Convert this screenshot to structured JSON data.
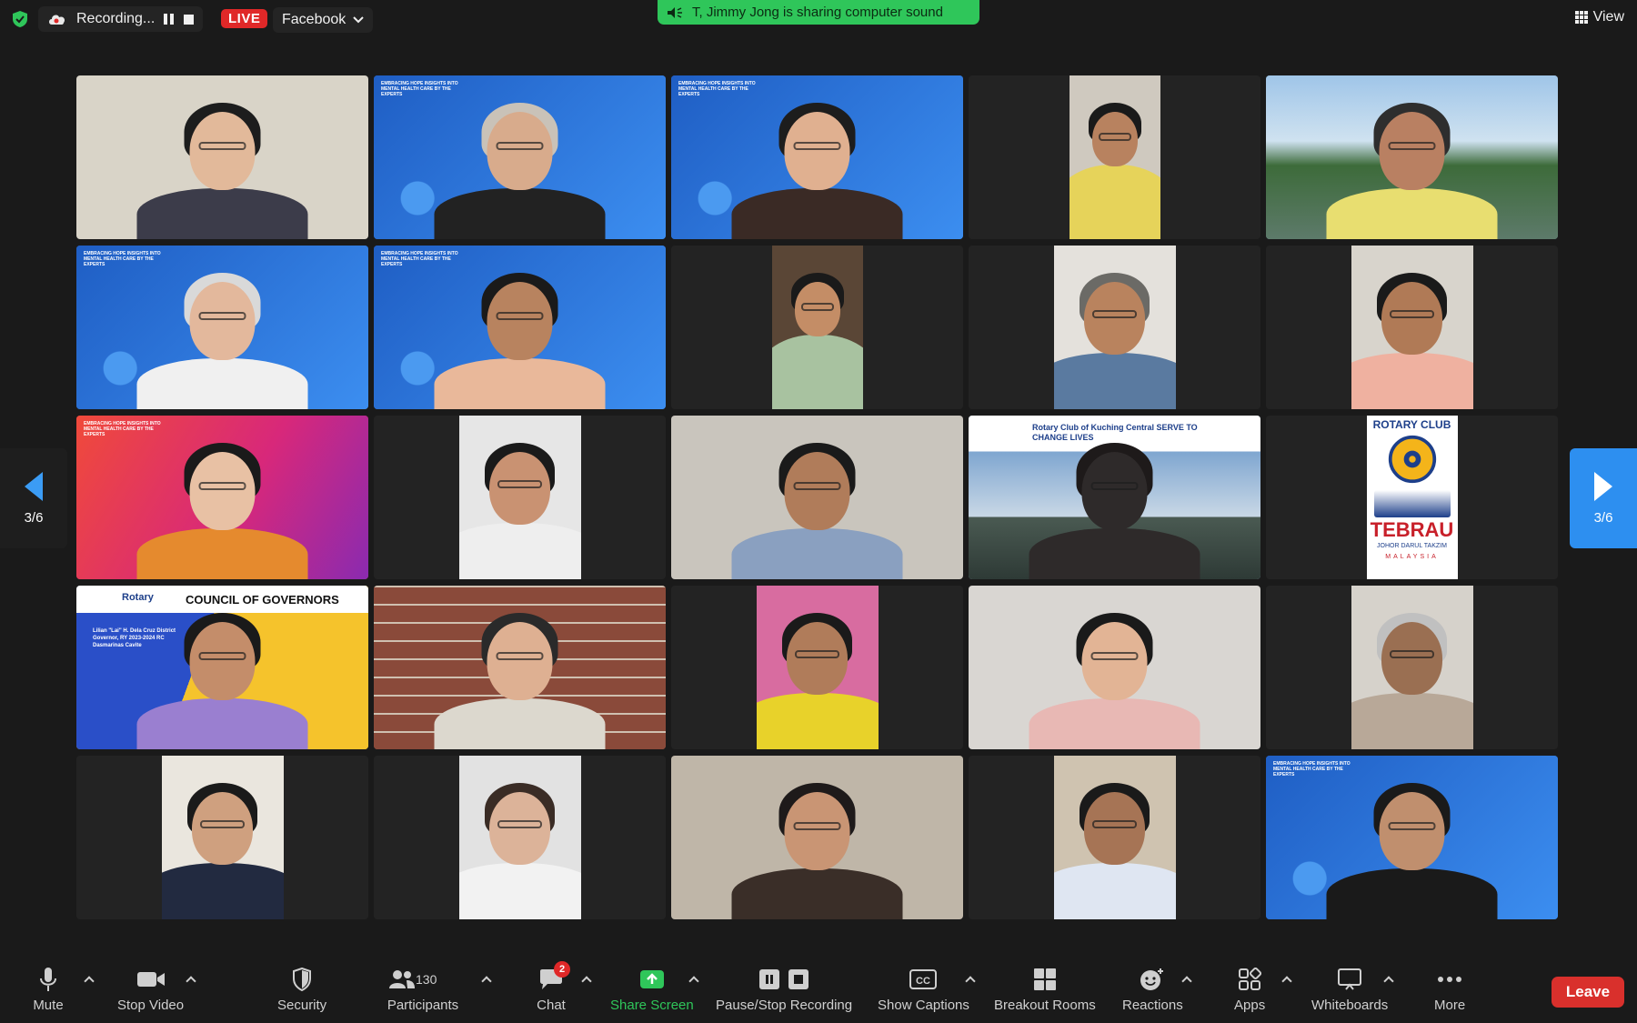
{
  "topbar": {
    "recording_label": "Recording...",
    "live_label": "LIVE",
    "stream_target": "Facebook",
    "sharing_notice": "T, Jimmy Jong is sharing computer sound",
    "view_label": "View"
  },
  "navigation": {
    "page_indicator_left": "3/6",
    "page_indicator_right": "3/6"
  },
  "tiles": [
    {
      "name": "participant-video-1",
      "bg": "#d9d4c8",
      "kind": "full"
    },
    {
      "name": "participant-video-2",
      "bg": "#2a6fd6",
      "kind": "full",
      "banner": "EMBRACING HOPE INSIGHTS INTO MENTAL HEALTH CARE BY THE EXPERTS"
    },
    {
      "name": "participant-video-3",
      "bg": "#2a6fd6",
      "kind": "full",
      "banner": "EMBRACING HOPE INSIGHTS INTO MENTAL HEALTH CARE BY THE EXPERTS"
    },
    {
      "name": "participant-video-4",
      "bg": "#cfc9bf",
      "kind": "pillar"
    },
    {
      "name": "participant-video-5",
      "bg": "#6b8fa8",
      "kind": "full"
    },
    {
      "name": "participant-video-6",
      "bg": "#2a6fd6",
      "kind": "full",
      "banner": "EMBRACING HOPE INSIGHTS INTO MENTAL HEALTH CARE BY THE EXPERTS"
    },
    {
      "name": "participant-video-7",
      "bg": "#2a6fd6",
      "kind": "full",
      "banner": "EMBRACING HOPE INSIGHTS INTO MENTAL HEALTH CARE BY THE EXPERTS"
    },
    {
      "name": "participant-video-8",
      "bg": "#5a4636",
      "kind": "pillar"
    },
    {
      "name": "participant-video-9",
      "bg": "#e4e1dc",
      "kind": "pillar"
    },
    {
      "name": "participant-video-10",
      "bg": "#d8d4cc",
      "kind": "pillar"
    },
    {
      "name": "participant-video-11",
      "bg": "#e0324e",
      "kind": "full",
      "banner": "EMBRACING HOPE INSIGHTS INTO MENTAL HEALTH CARE BY THE EXPERTS"
    },
    {
      "name": "participant-video-12",
      "bg": "#e6e6e6",
      "kind": "pillar"
    },
    {
      "name": "participant-video-13",
      "bg": "#c9c5bd",
      "kind": "full"
    },
    {
      "name": "participant-video-14",
      "bg": "#8fb0cc",
      "kind": "full",
      "banner": "Rotary Club of Kuching Central  SERVE TO CHANGE LIVES"
    },
    {
      "name": "participant-video-15",
      "bg": "#ffffff",
      "kind": "pillar",
      "logo_title": "ROTARY CLUB",
      "logo_name": "TEBRAU",
      "logo_sub": "JOHOR DARUL TAKZIM",
      "logo_country": "MALAYSIA"
    },
    {
      "name": "participant-video-16",
      "bg": "#f5c32c",
      "kind": "full",
      "banner_title": "COUNCIL OF GOVERNORS",
      "banner_brand": "Rotary",
      "banner_caption": "Lilian \"Lai\" H. Dela Cruz District Governor, RY 2023-2024 RC Dasmarinas Cavite"
    },
    {
      "name": "participant-video-17",
      "bg": "#9a5a4a",
      "kind": "full"
    },
    {
      "name": "participant-video-18",
      "bg": "#d86ca0",
      "kind": "pillar"
    },
    {
      "name": "participant-video-19",
      "bg": "#d9d6d2",
      "kind": "full"
    },
    {
      "name": "participant-video-20",
      "bg": "#d6d2cb",
      "kind": "pillar"
    },
    {
      "name": "participant-video-21",
      "bg": "#eae6de",
      "kind": "pillar"
    },
    {
      "name": "participant-video-22",
      "bg": "#e2e2e2",
      "kind": "pillar"
    },
    {
      "name": "participant-video-23",
      "bg": "#bfb6a8",
      "kind": "full"
    },
    {
      "name": "participant-video-24",
      "bg": "#cfc3b0",
      "kind": "pillar"
    },
    {
      "name": "participant-video-25",
      "bg": "#2a6fd6",
      "kind": "full",
      "banner": "EMBRACING HOPE INSIGHTS INTO MENTAL HEALTH CARE BY THE EXPERTS"
    }
  ],
  "toolbar": {
    "mute_label": "Mute",
    "stop_video_label": "Stop Video",
    "security_label": "Security",
    "participants_label": "Participants",
    "participants_count": "130",
    "chat_label": "Chat",
    "chat_badge": "2",
    "share_screen_label": "Share Screen",
    "pause_recording_label": "Pause/Stop Recording",
    "captions_label": "Show Captions",
    "cc_icon_text": "CC",
    "breakout_label": "Breakout Rooms",
    "reactions_label": "Reactions",
    "apps_label": "Apps",
    "whiteboards_label": "Whiteboards",
    "more_label": "More",
    "leave_label": "Leave"
  },
  "colors": {
    "accent_green": "#2fc65a",
    "live_red": "#e02828",
    "nav_blue": "#2d8ff0",
    "leave_red": "#d9302c"
  }
}
